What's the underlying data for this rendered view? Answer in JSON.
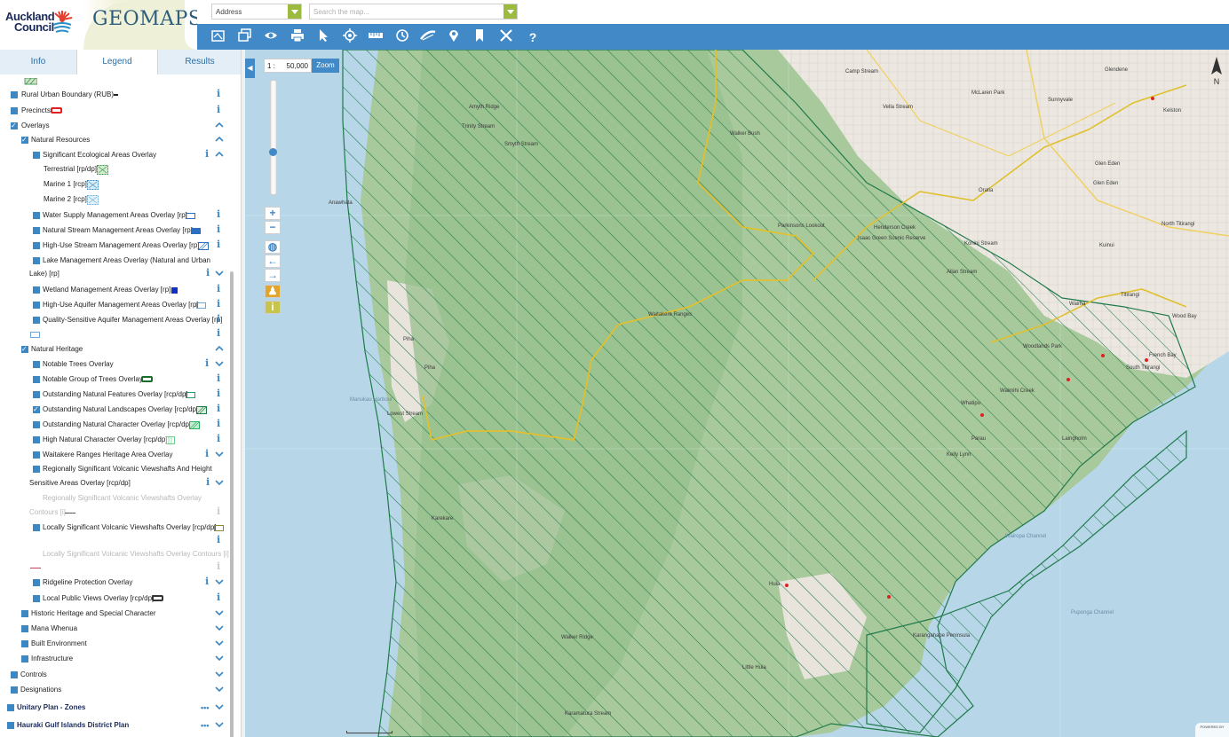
{
  "header": {
    "council_name_line1": "Auckland",
    "council_name_line2": "Council",
    "app_name": "GEOMAPS",
    "address_dropdown": "Address",
    "search_placeholder": "Search the map...",
    "toolbar_icons": [
      "basemap-icon",
      "layers-icon",
      "eye-icon",
      "print-icon",
      "select-icon",
      "locate-icon",
      "measure-icon",
      "history-icon",
      "route-icon",
      "pin-icon",
      "bookmark-icon",
      "tools-icon",
      "help-icon"
    ],
    "help_label": "?"
  },
  "tabs": [
    {
      "label": "Info"
    },
    {
      "label": "Legend"
    },
    {
      "label": "Results"
    }
  ],
  "legend": {
    "rural_urban_boundary": "Rural Urban Boundary (RUB)",
    "precincts": "Precincts",
    "overlays": "Overlays",
    "natural_resources": "Natural Resources",
    "sig_eco": "Significant Ecological Areas Overlay",
    "terrestrial": "Terrestrial [rp/dp]",
    "marine1": "Marine 1 [rcp]",
    "marine2": "Marine 2 [rcp]",
    "water_supply": "Water Supply Management Areas Overlay [rp]",
    "natural_stream": "Natural Stream Management Areas Overlay [rp]",
    "high_use_stream": "High-Use Stream Management Areas Overlay [rp]",
    "lake_mgmt_1": "Lake Management Areas Overlay (Natural and Urban",
    "lake_mgmt_2": "Lake) [rp]",
    "wetland": "Wetland Management Areas Overlay [rp]",
    "high_use_aquifer": "High-Use Aquifer Management Areas Overlay [rp]",
    "quality_aquifer": "Quality-Sensitive Aquifer Management Areas Overlay [rp]",
    "natural_heritage": "Natural Heritage",
    "notable_trees": "Notable Trees Overlay",
    "notable_group": "Notable Group of Trees Overlay",
    "outstanding_features": "Outstanding Natural Features Overlay [rcp/dp]",
    "outstanding_landscapes": "Outstanding Natural Landscapes Overlay [rcp/dp]",
    "outstanding_character": "Outstanding Natural Character Overlay [rcp/dp]",
    "high_character": "High Natural Character Overlay [rcp/dp]",
    "waitakere": "Waitakere Ranges Heritage Area Overlay",
    "regional_volcanic_1": "Regionally Significant Volcanic Viewshafts And Height",
    "regional_volcanic_2": "Sensitive Areas Overlay [rcp/dp]",
    "regional_contours_1": "Regionally Significant Volcanic Viewshafts Overlay",
    "regional_contours_2": "Contours [i]",
    "local_volcanic": "Locally Significant Volcanic Viewshafts Overlay [rcp/dp]",
    "local_contours": "Locally Significant Volcanic Viewshafts Overlay Contours [i]",
    "ridgeline": "Ridgeline Protection Overlay",
    "local_views": "Local Public Views Overlay [rcp/dp]",
    "historic": "Historic Heritage and Special Character",
    "mana_whenua": "Mana Whenua",
    "built_env": "Built Environment",
    "infrastructure": "Infrastructure",
    "controls": "Controls",
    "designations": "Designations",
    "unitary_zones": "Unitary Plan - Zones",
    "hauraki": "Hauraki Gulf Islands District Plan",
    "info_glyph": "i",
    "more_glyph": "•••"
  },
  "map": {
    "scale_prefix": "1 :",
    "scale_value": "50,000",
    "zoom_label": "Zoom",
    "north_label": "N",
    "powered_by": "POWERED BY",
    "places": [
      "Camp Stream",
      "McLaren Park",
      "Glendene",
      "Sunnyvale",
      "Kelston",
      "Amyth Ridge",
      "Vella Stream",
      "Trinity Stream",
      "Smyth Stream",
      "Walker Bush",
      "Glen Eden",
      "Glen Eden",
      "Oratia",
      "North Titirangi",
      "Kuinui",
      "Isaac Green Scenic Reserve",
      "Parkinsons Lookout",
      "Henderson Creek",
      "Allan Stream",
      "Konini Stream",
      "Waitakere Ranges",
      "Waima",
      "Titirangi",
      "Wood Bay",
      "Woodlands Park",
      "French Bay",
      "South Titirangi",
      "Piha",
      "Karekare",
      "Lowest Stream",
      "Waimihi Creek",
      "Laingholm",
      "Kelly Lynn",
      "Parau",
      "Whatipu",
      "Huia",
      "Walker Ridge",
      "Little Huia",
      "Karangahape Peninsula",
      "Karamatura Stream",
      "Piha",
      "Anawhata"
    ],
    "seas": [
      "Manukau Harbour",
      "Puponga Channel",
      "Wairopa Channel"
    ]
  },
  "colors": {
    "accent_blue": "#4189c7",
    "legend_blue": "#3d87c3",
    "sea": "#b7d7e8",
    "forest": "#a3c89a",
    "hatch": "#1f7a4a",
    "boundary": "#e0c02e"
  }
}
